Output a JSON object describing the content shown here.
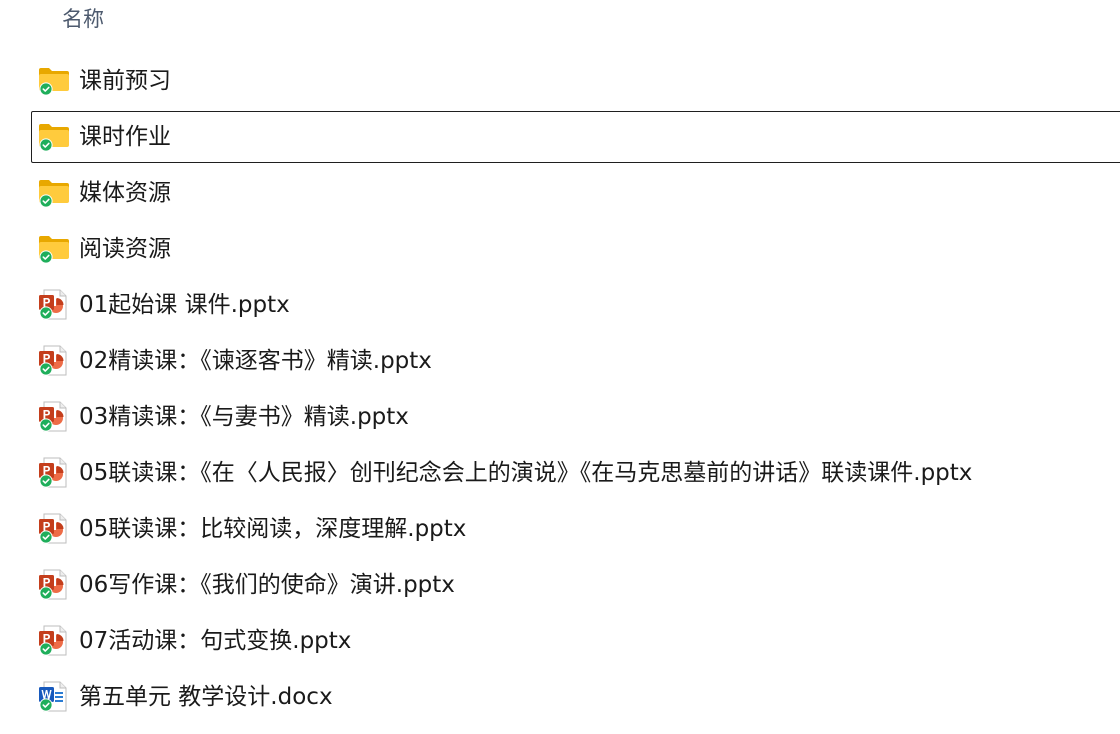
{
  "header": {
    "name_column": "名称"
  },
  "files": [
    {
      "name": "课前预习",
      "type": "folder",
      "icon": "folder-icon",
      "sync": "synced"
    },
    {
      "name": "课时作业",
      "type": "folder",
      "icon": "folder-icon",
      "sync": "synced",
      "selected": true
    },
    {
      "name": "媒体资源",
      "type": "folder",
      "icon": "folder-icon",
      "sync": "synced"
    },
    {
      "name": "阅读资源",
      "type": "folder",
      "icon": "folder-icon",
      "sync": "synced"
    },
    {
      "name": "01起始课 课件.pptx",
      "type": "pptx",
      "icon": "powerpoint-file-icon",
      "sync": "synced"
    },
    {
      "name": "02精读课：《谏逐客书》精读.pptx",
      "type": "pptx",
      "icon": "powerpoint-file-icon",
      "sync": "synced"
    },
    {
      "name": "03精读课：《与妻书》精读.pptx",
      "type": "pptx",
      "icon": "powerpoint-file-icon",
      "sync": "synced"
    },
    {
      "name": "05联读课：《在〈人民报〉创刊纪念会上的演说》《在马克思墓前的讲话》联读课件.pptx",
      "type": "pptx",
      "icon": "powerpoint-file-icon",
      "sync": "synced"
    },
    {
      "name": "05联读课：比较阅读，深度理解.pptx",
      "type": "pptx",
      "icon": "powerpoint-file-icon",
      "sync": "synced"
    },
    {
      "name": "06写作课：《我们的使命》演讲.pptx",
      "type": "pptx",
      "icon": "powerpoint-file-icon",
      "sync": "synced"
    },
    {
      "name": "07活动课：句式变换.pptx",
      "type": "pptx",
      "icon": "powerpoint-file-icon",
      "sync": "synced"
    },
    {
      "name": "第五单元 教学设计.docx",
      "type": "docx",
      "icon": "word-file-icon",
      "sync": "synced"
    }
  ],
  "colors": {
    "folder_back": "#e8a800",
    "folder_front": "#ffcb3d",
    "ppt_red": "#c43e1c",
    "ppt_orange": "#ed6c47",
    "word_blue": "#185abd",
    "sync_green": "#1fae5b",
    "selection_border": "#1f1f1f",
    "header_text": "#4d5a6e"
  }
}
